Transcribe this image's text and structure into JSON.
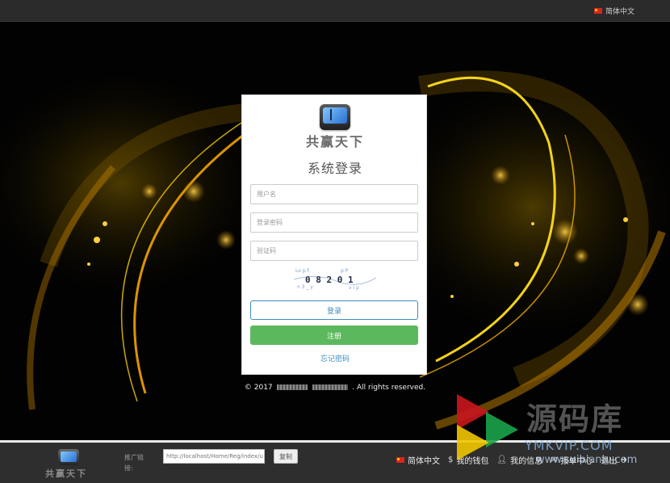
{
  "topbar": {
    "language": "简体中文"
  },
  "login": {
    "brand": "共赢天下",
    "title": "系统登录",
    "username_placeholder": "用户名",
    "password_placeholder": "登录密码",
    "captcha_placeholder": "验证码",
    "captcha_text": "0 8 2 0 1",
    "login_button": "登录",
    "register_button": "注册",
    "forgot_link": "忘记密码"
  },
  "copyright": {
    "prefix": "© 2017",
    "suffix": ". All rights reserved."
  },
  "footer": {
    "brand": "共赢天下",
    "promo_label": "推广链接:",
    "promo_link": "http://localhost/Home/Reg/index/u",
    "copy_button": "复制",
    "nav": [
      "简体中文",
      "我的钱包",
      "我的信息",
      "报单中心",
      "退出"
    ]
  },
  "watermark": {
    "line1": "源码库",
    "line2": "YMKVIP.COM",
    "line3": "www.suibianlu.com"
  },
  "colors": {
    "accent_blue": "#3c8dbc",
    "register_green": "#5cb85c",
    "topbar": "#2b2b2b",
    "footer": "#2e2e2e"
  }
}
